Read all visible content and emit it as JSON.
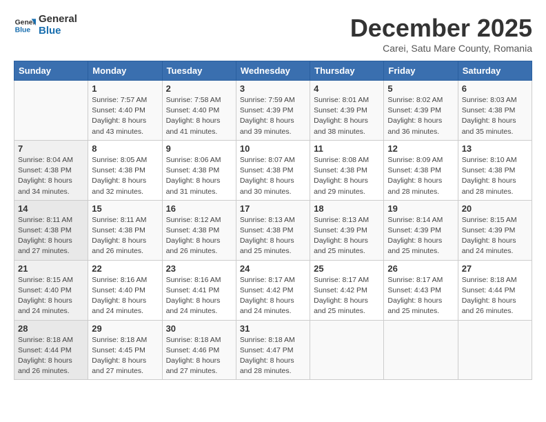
{
  "logo": {
    "line1": "General",
    "line2": "Blue"
  },
  "title": "December 2025",
  "subtitle": "Carei, Satu Mare County, Romania",
  "weekdays": [
    "Sunday",
    "Monday",
    "Tuesday",
    "Wednesday",
    "Thursday",
    "Friday",
    "Saturday"
  ],
  "weeks": [
    [
      {
        "day": "",
        "detail": ""
      },
      {
        "day": "1",
        "detail": "Sunrise: 7:57 AM\nSunset: 4:40 PM\nDaylight: 8 hours\nand 43 minutes."
      },
      {
        "day": "2",
        "detail": "Sunrise: 7:58 AM\nSunset: 4:40 PM\nDaylight: 8 hours\nand 41 minutes."
      },
      {
        "day": "3",
        "detail": "Sunrise: 7:59 AM\nSunset: 4:39 PM\nDaylight: 8 hours\nand 39 minutes."
      },
      {
        "day": "4",
        "detail": "Sunrise: 8:01 AM\nSunset: 4:39 PM\nDaylight: 8 hours\nand 38 minutes."
      },
      {
        "day": "5",
        "detail": "Sunrise: 8:02 AM\nSunset: 4:39 PM\nDaylight: 8 hours\nand 36 minutes."
      },
      {
        "day": "6",
        "detail": "Sunrise: 8:03 AM\nSunset: 4:38 PM\nDaylight: 8 hours\nand 35 minutes."
      }
    ],
    [
      {
        "day": "7",
        "detail": "Sunrise: 8:04 AM\nSunset: 4:38 PM\nDaylight: 8 hours\nand 34 minutes."
      },
      {
        "day": "8",
        "detail": "Sunrise: 8:05 AM\nSunset: 4:38 PM\nDaylight: 8 hours\nand 32 minutes."
      },
      {
        "day": "9",
        "detail": "Sunrise: 8:06 AM\nSunset: 4:38 PM\nDaylight: 8 hours\nand 31 minutes."
      },
      {
        "day": "10",
        "detail": "Sunrise: 8:07 AM\nSunset: 4:38 PM\nDaylight: 8 hours\nand 30 minutes."
      },
      {
        "day": "11",
        "detail": "Sunrise: 8:08 AM\nSunset: 4:38 PM\nDaylight: 8 hours\nand 29 minutes."
      },
      {
        "day": "12",
        "detail": "Sunrise: 8:09 AM\nSunset: 4:38 PM\nDaylight: 8 hours\nand 28 minutes."
      },
      {
        "day": "13",
        "detail": "Sunrise: 8:10 AM\nSunset: 4:38 PM\nDaylight: 8 hours\nand 28 minutes."
      }
    ],
    [
      {
        "day": "14",
        "detail": "Sunrise: 8:11 AM\nSunset: 4:38 PM\nDaylight: 8 hours\nand 27 minutes."
      },
      {
        "day": "15",
        "detail": "Sunrise: 8:11 AM\nSunset: 4:38 PM\nDaylight: 8 hours\nand 26 minutes."
      },
      {
        "day": "16",
        "detail": "Sunrise: 8:12 AM\nSunset: 4:38 PM\nDaylight: 8 hours\nand 26 minutes."
      },
      {
        "day": "17",
        "detail": "Sunrise: 8:13 AM\nSunset: 4:38 PM\nDaylight: 8 hours\nand 25 minutes."
      },
      {
        "day": "18",
        "detail": "Sunrise: 8:13 AM\nSunset: 4:39 PM\nDaylight: 8 hours\nand 25 minutes."
      },
      {
        "day": "19",
        "detail": "Sunrise: 8:14 AM\nSunset: 4:39 PM\nDaylight: 8 hours\nand 25 minutes."
      },
      {
        "day": "20",
        "detail": "Sunrise: 8:15 AM\nSunset: 4:39 PM\nDaylight: 8 hours\nand 24 minutes."
      }
    ],
    [
      {
        "day": "21",
        "detail": "Sunrise: 8:15 AM\nSunset: 4:40 PM\nDaylight: 8 hours\nand 24 minutes."
      },
      {
        "day": "22",
        "detail": "Sunrise: 8:16 AM\nSunset: 4:40 PM\nDaylight: 8 hours\nand 24 minutes."
      },
      {
        "day": "23",
        "detail": "Sunrise: 8:16 AM\nSunset: 4:41 PM\nDaylight: 8 hours\nand 24 minutes."
      },
      {
        "day": "24",
        "detail": "Sunrise: 8:17 AM\nSunset: 4:42 PM\nDaylight: 8 hours\nand 24 minutes."
      },
      {
        "day": "25",
        "detail": "Sunrise: 8:17 AM\nSunset: 4:42 PM\nDaylight: 8 hours\nand 25 minutes."
      },
      {
        "day": "26",
        "detail": "Sunrise: 8:17 AM\nSunset: 4:43 PM\nDaylight: 8 hours\nand 25 minutes."
      },
      {
        "day": "27",
        "detail": "Sunrise: 8:18 AM\nSunset: 4:44 PM\nDaylight: 8 hours\nand 26 minutes."
      }
    ],
    [
      {
        "day": "28",
        "detail": "Sunrise: 8:18 AM\nSunset: 4:44 PM\nDaylight: 8 hours\nand 26 minutes."
      },
      {
        "day": "29",
        "detail": "Sunrise: 8:18 AM\nSunset: 4:45 PM\nDaylight: 8 hours\nand 27 minutes."
      },
      {
        "day": "30",
        "detail": "Sunrise: 8:18 AM\nSunset: 4:46 PM\nDaylight: 8 hours\nand 27 minutes."
      },
      {
        "day": "31",
        "detail": "Sunrise: 8:18 AM\nSunset: 4:47 PM\nDaylight: 8 hours\nand 28 minutes."
      },
      {
        "day": "",
        "detail": ""
      },
      {
        "day": "",
        "detail": ""
      },
      {
        "day": "",
        "detail": ""
      }
    ]
  ]
}
